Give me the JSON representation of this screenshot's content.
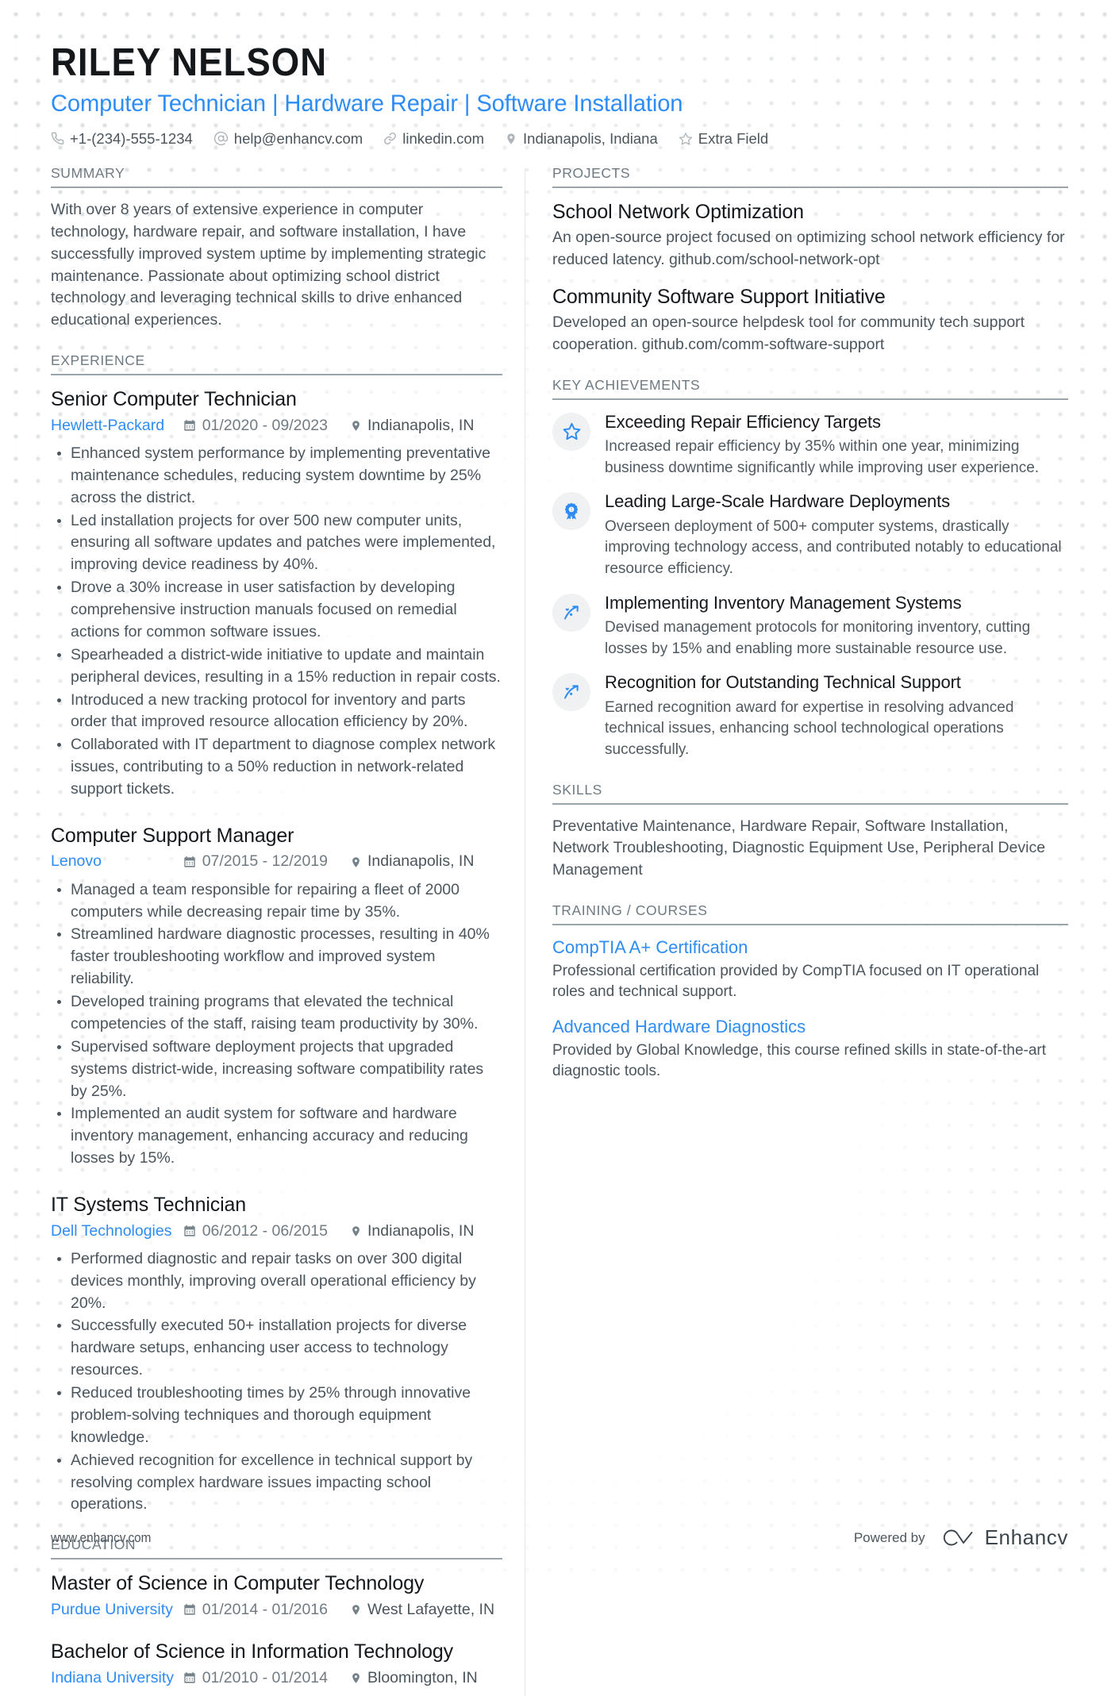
{
  "header": {
    "name": "RILEY NELSON",
    "headline": "Computer Technician | Hardware Repair | Software Installation",
    "contacts": [
      {
        "icon": "phone-icon",
        "text": "+1-(234)-555-1234"
      },
      {
        "icon": "email-icon",
        "text": "help@enhancv.com"
      },
      {
        "icon": "link-icon",
        "text": "linkedin.com"
      },
      {
        "icon": "location-icon",
        "text": "Indianapolis, Indiana"
      },
      {
        "icon": "star-icon",
        "text": "Extra Field"
      }
    ]
  },
  "summary": {
    "title": "SUMMARY",
    "text": "With over 8 years of extensive experience in computer technology, hardware repair, and software installation, I have successfully improved system uptime by implementing strategic maintenance. Passionate about optimizing school district technology and leveraging technical skills to drive enhanced educational experiences."
  },
  "experience": {
    "title": "EXPERIENCE",
    "entries": [
      {
        "role": "Senior Computer Technician",
        "company": "Hewlett-Packard",
        "dates": "01/2020 - 09/2023",
        "location": "Indianapolis, IN",
        "bullets": [
          "Enhanced system performance by implementing preventative maintenance schedules, reducing system downtime by 25% across the district.",
          "Led installation projects for over 500 new computer units, ensuring all software updates and patches were implemented, improving device readiness by 40%.",
          "Drove a 30% increase in user satisfaction by developing comprehensive instruction manuals focused on remedial actions for common software issues.",
          "Spearheaded a district-wide initiative to update and maintain peripheral devices, resulting in a 15% reduction in repair costs.",
          "Introduced a new tracking protocol for inventory and parts order that improved resource allocation efficiency by 20%.",
          "Collaborated with IT department to diagnose complex network issues, contributing to a 50% reduction in network-related support tickets."
        ]
      },
      {
        "role": "Computer Support Manager",
        "company": "Lenovo",
        "dates": "07/2015 - 12/2019",
        "location": "Indianapolis, IN",
        "bullets": [
          "Managed a team responsible for repairing a fleet of 2000 computers while decreasing repair time by 35%.",
          "Streamlined hardware diagnostic processes, resulting in 40% faster troubleshooting workflow and improved system reliability.",
          "Developed training programs that elevated the technical competencies of the staff, raising team productivity by 30%.",
          "Supervised software deployment projects that upgraded systems district-wide, increasing software compatibility rates by 25%.",
          "Implemented an audit system for software and hardware inventory management, enhancing accuracy and reducing losses by 15%."
        ]
      },
      {
        "role": "IT Systems Technician",
        "company": "Dell Technologies",
        "dates": "06/2012 - 06/2015",
        "location": "Indianapolis, IN",
        "bullets": [
          "Performed diagnostic and repair tasks on over 300 digital devices monthly, improving overall operational efficiency by 20%.",
          "Successfully executed 50+ installation projects for diverse hardware setups, enhancing user access to technology resources.",
          "Reduced troubleshooting times by 25% through innovative problem-solving techniques and thorough equipment knowledge.",
          "Achieved recognition for excellence in technical support by resolving complex hardware issues impacting school operations."
        ]
      }
    ]
  },
  "education": {
    "title": "EDUCATION",
    "entries": [
      {
        "degree": "Master of Science in Computer Technology",
        "school": "Purdue University",
        "dates": "01/2014 - 01/2016",
        "location": "West Lafayette, IN"
      },
      {
        "degree": "Bachelor of Science in Information Technology",
        "school": "Indiana University",
        "dates": "01/2010 - 01/2014",
        "location": "Bloomington, IN"
      }
    ]
  },
  "projects": {
    "title": "PROJECTS",
    "items": [
      {
        "name": "School Network Optimization",
        "description": "An open-source project focused on optimizing school network efficiency for reduced latency. github.com/school-network-opt"
      },
      {
        "name": "Community Software Support Initiative",
        "description": "Developed an open-source helpdesk tool for community tech support cooperation. github.com/comm-software-support"
      }
    ]
  },
  "achievements": {
    "title": "KEY ACHIEVEMENTS",
    "items": [
      {
        "icon": "star-outline-icon",
        "title": "Exceeding Repair Efficiency Targets",
        "description": "Increased repair efficiency by 35% within one year, minimizing business downtime significantly while improving user experience."
      },
      {
        "icon": "award-ribbon-icon",
        "title": "Leading Large-Scale Hardware Deployments",
        "description": "Overseen deployment of 500+ computer systems, drastically improving technology access, and contributed notably to educational resource efficiency."
      },
      {
        "icon": "trending-arrow-icon",
        "title": "Implementing Inventory Management Systems",
        "description": "Devised management protocols for monitoring inventory, cutting losses by 15% and enabling more sustainable resource use."
      },
      {
        "icon": "trending-arrow-icon",
        "title": "Recognition for Outstanding Technical Support",
        "description": "Earned recognition award for expertise in resolving advanced technical issues, enhancing school technological operations successfully."
      }
    ]
  },
  "skills": {
    "title": "SKILLS",
    "text": "Preventative Maintenance, Hardware Repair, Software Installation, Network Troubleshooting, Diagnostic Equipment Use, Peripheral Device Management"
  },
  "training": {
    "title": "TRAINING / COURSES",
    "items": [
      {
        "name": "CompTIA A+ Certification",
        "description": "Professional certification provided by CompTIA focused on IT operational roles and technical support."
      },
      {
        "name": "Advanced Hardware Diagnostics",
        "description": "Provided by Global Knowledge, this course refined skills in state-of-the-art diagnostic tools."
      }
    ]
  },
  "footer": {
    "url": "www.enhancv.com",
    "powered_by": "Powered by",
    "brand": "Enhancv"
  },
  "colors": {
    "accent": "#2d8cf5",
    "text": "#4a555d",
    "heading": "#13181c",
    "muted": "#6e7a82"
  }
}
